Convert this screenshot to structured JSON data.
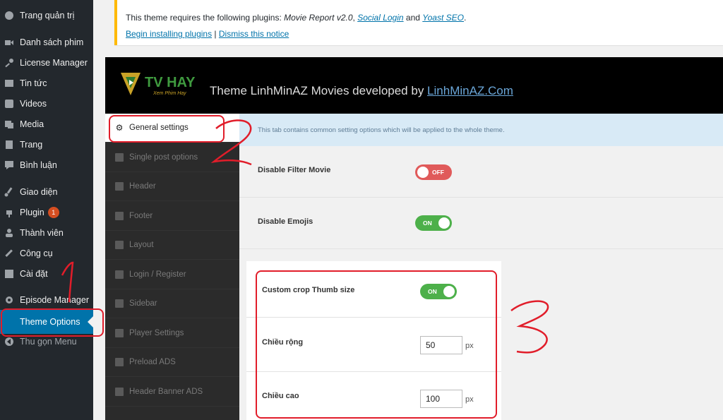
{
  "sidebar": {
    "items": [
      {
        "label": "Trang quản trị",
        "icon": "dashboard-icon"
      },
      {
        "label": "Danh sách phim",
        "icon": "video-camera-icon"
      },
      {
        "label": "License Manager",
        "icon": "key-icon"
      },
      {
        "label": "Tin tức",
        "icon": "news-icon"
      },
      {
        "label": "Videos",
        "icon": "play-icon"
      },
      {
        "label": "Media",
        "icon": "media-icon"
      },
      {
        "label": "Trang",
        "icon": "page-icon"
      },
      {
        "label": "Bình luận",
        "icon": "comment-icon"
      },
      {
        "label": "Giao diện",
        "icon": "brush-icon"
      },
      {
        "label": "Plugin",
        "icon": "plugin-icon",
        "badge": "1"
      },
      {
        "label": "Thành viên",
        "icon": "user-icon"
      },
      {
        "label": "Công cụ",
        "icon": "wrench-icon"
      },
      {
        "label": "Cài đặt",
        "icon": "settings-icon"
      },
      {
        "label": "Episode Manager",
        "icon": "gear-icon"
      },
      {
        "label": "Theme Options",
        "icon": "",
        "active": true
      },
      {
        "label": "Thu gọn Menu",
        "icon": "collapse-icon"
      }
    ]
  },
  "notice": {
    "text_prefix": "This theme requires the following plugins: ",
    "plugin1": "Movie Report v2.0",
    "sep1": ", ",
    "plugin2": "Social Login",
    "sep2": " and ",
    "plugin3": "Yoast SEO",
    "suffix": ".",
    "install_link": "Begin installing plugins",
    "divider": " | ",
    "dismiss_link": "Dismiss this notice"
  },
  "panel": {
    "logo_text": "TV HAY",
    "logo_sub": "Xem Phim Hay",
    "title_prefix": "Theme LinhMinAZ Movies developed by ",
    "title_link": "LinhMinAZ.Com"
  },
  "tabs": [
    {
      "label": "General settings",
      "active": true
    },
    {
      "label": "Single post options"
    },
    {
      "label": "Header"
    },
    {
      "label": "Footer"
    },
    {
      "label": "Layout"
    },
    {
      "label": "Login / Register"
    },
    {
      "label": "Sidebar"
    },
    {
      "label": "Player Settings"
    },
    {
      "label": "Preload ADS"
    },
    {
      "label": "Header Banner ADS"
    }
  ],
  "content": {
    "description": "This tab contains common setting options which will be applied to the whole theme.",
    "settings": [
      {
        "label": "Disable Filter Movie",
        "toggle": "OFF"
      },
      {
        "label": "Disable Emojis",
        "toggle": "ON"
      }
    ],
    "thumb": {
      "label": "Custom crop Thumb size",
      "toggle": "ON",
      "width_label": "Chiều rộng",
      "width_value": "50",
      "height_label": "Chiều cao",
      "height_value": "100",
      "unit": "px"
    }
  },
  "annotations": {
    "step1": "1",
    "step2": "2",
    "step3": "3",
    "color": "#e11d2a"
  },
  "colors": {
    "wp_sidebar": "#23282d",
    "wp_active": "#0073aa",
    "toggle_on": "#4db04a",
    "toggle_off": "#e05a5a",
    "notice_border": "#ffb900"
  }
}
